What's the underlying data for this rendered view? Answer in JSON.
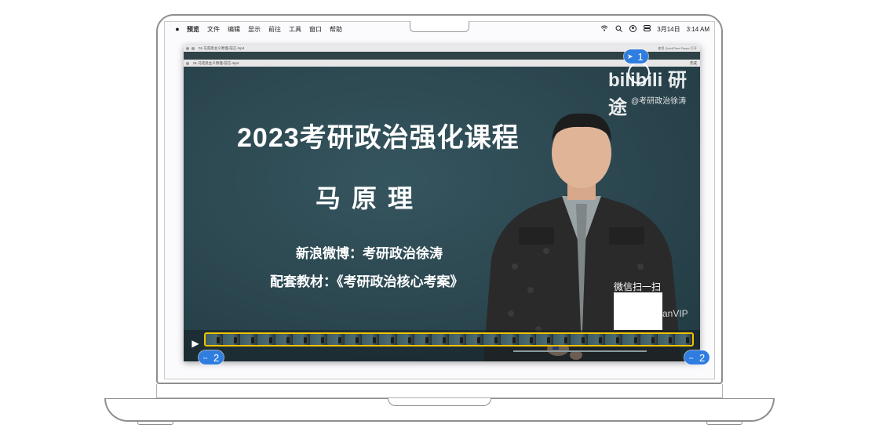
{
  "menubar": {
    "apple": "",
    "app_name": "预览",
    "items": [
      "文件",
      "编辑",
      "显示",
      "前往",
      "工具",
      "窗口",
      "帮助"
    ],
    "date": "3月14日",
    "time": "3:14 AM"
  },
  "window": {
    "title": "01.马克思主义原理-前言.mp4",
    "title2": "01.马克思主义原理-前言.mp4",
    "open_with": "使用 QuickTime Player 打开",
    "done": "完成"
  },
  "video": {
    "headline": "2023考研政治强化课程",
    "subject": "马原理",
    "weibo": "新浪微博：考研政治徐涛",
    "textbook": "配套教材：《考研政治核心考案》",
    "brand": "bilibili 研途",
    "handle": "@考研政治徐涛",
    "wechat_label": "微信扫一扫",
    "vip_text": "anVIP"
  },
  "badges": {
    "top": "1",
    "left": "2",
    "right": "2"
  },
  "icons": {
    "play": "play-icon",
    "trim_left": "trim-handle-icon",
    "trim_right": "trim-handle-icon"
  },
  "colors": {
    "badge": "#2f7de1",
    "trim_border": "#f2c200"
  }
}
